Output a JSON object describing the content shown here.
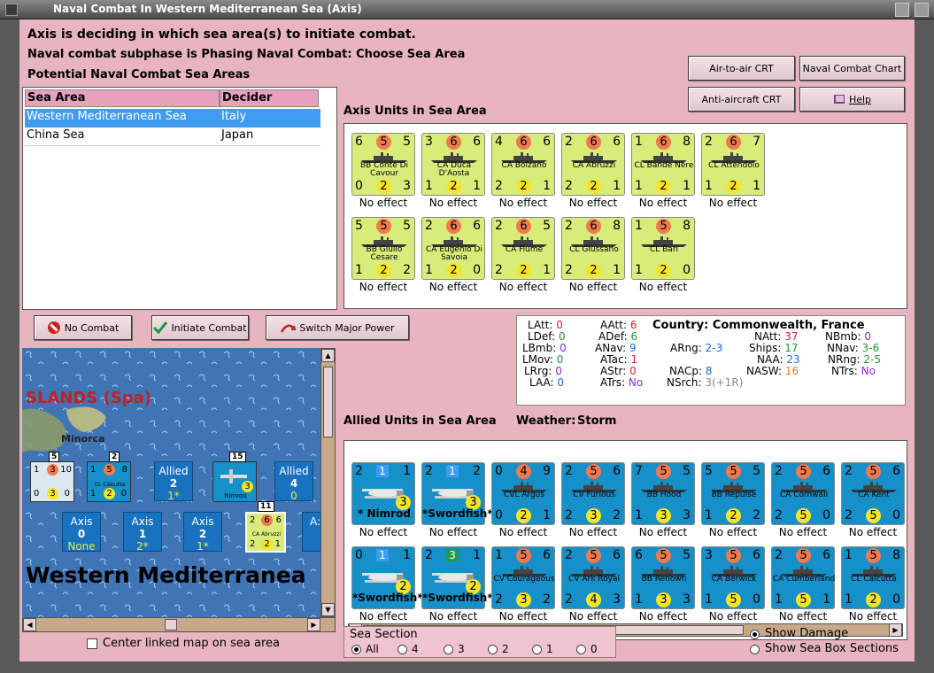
{
  "window": {
    "title": "Naval Combat In Western Mediterranean Sea (Axis)"
  },
  "header": {
    "line1": "Axis is deciding in which sea area(s) to initiate combat.",
    "line2": "Naval combat subphase is Phasing Naval Combat: Choose Sea Area",
    "line3": "Potential Naval Combat Sea Areas"
  },
  "buttons": {
    "air_to_air": "Air-to-air CRT",
    "naval_chart": "Naval Combat Chart",
    "anti_aircraft": "Anti-aircraft CRT",
    "help": "Help",
    "no_combat": "No Combat",
    "initiate_combat": "Initiate Combat",
    "switch_major": "Switch Major Power"
  },
  "sea_table": {
    "col_area": "Sea Area",
    "col_decider": "Decider",
    "rows": [
      {
        "area": "Western Mediterranean Sea",
        "decider": "Italy"
      },
      {
        "area": "China Sea",
        "decider": "Japan"
      }
    ]
  },
  "axis_panel": {
    "title": "Axis Units in Sea Area",
    "units": [
      {
        "name": "BB Conte Di Cavour",
        "tl": "6",
        "tc": "5",
        "tr": "5",
        "bl": "0",
        "bc": "2",
        "br": "3",
        "effect": "No effect"
      },
      {
        "name": "CA Duca D'Aosta",
        "tl": "3",
        "tc": "6",
        "tr": "6",
        "bl": "1",
        "bc": "2",
        "br": "1",
        "effect": "No effect"
      },
      {
        "name": "CA Bolzano",
        "tl": "4",
        "tc": "6",
        "tr": "6",
        "bl": "2",
        "bc": "2",
        "br": "1",
        "effect": "No effect"
      },
      {
        "name": "CA Abruzzi",
        "tl": "2",
        "tc": "6",
        "tr": "6",
        "bl": "2",
        "bc": "2",
        "br": "1",
        "effect": "No effect"
      },
      {
        "name": "CL Bande Nere",
        "tl": "1",
        "tc": "6",
        "tr": "8",
        "bl": "1",
        "bc": "2",
        "br": "1",
        "effect": "No effect"
      },
      {
        "name": "CL Attendolo",
        "tl": "2",
        "tc": "6",
        "tr": "7",
        "bl": "1",
        "bc": "2",
        "br": "1",
        "effect": "No effect"
      },
      {
        "name": "BB Giulio Cesare",
        "tl": "5",
        "tc": "5",
        "tr": "5",
        "bl": "1",
        "bc": "2",
        "br": "2",
        "effect": "No effect"
      },
      {
        "name": "CA Eugenio Di Savoia",
        "tl": "2",
        "tc": "6",
        "tr": "6",
        "bl": "1",
        "bc": "2",
        "br": "0",
        "effect": "No effect"
      },
      {
        "name": "CA Fiume",
        "tl": "2",
        "tc": "6",
        "tr": "5",
        "bl": "2",
        "bc": "2",
        "br": "1",
        "effect": "No effect"
      },
      {
        "name": "CL Giussano",
        "tl": "2",
        "tc": "6",
        "tr": "8",
        "bl": "2",
        "bc": "2",
        "br": "1",
        "effect": "No effect"
      },
      {
        "name": "CL Bari",
        "tl": "1",
        "tc": "5",
        "tr": "8",
        "bl": "1",
        "bc": "2",
        "br": "0",
        "effect": "No effect"
      }
    ]
  },
  "stats": {
    "latt": "LAtt:",
    "latt_v": "0",
    "ldef": "LDef:",
    "ldef_v": "0",
    "lbmb": "LBmb:",
    "lbmb_v": "0",
    "lmov": "LMov:",
    "lmov_v": "0",
    "lrrg": "LRrg:",
    "lrrg_v": "0",
    "laa": "LAA:",
    "laa_v": "0",
    "aatt": "AAtt:",
    "aatt_v": "6",
    "adef": "ADef:",
    "adef_v": "6",
    "anav": "ANav:",
    "anav_v": "9",
    "atac": "ATac:",
    "atac_v": "1",
    "astr": "AStr:",
    "astr_v": "0",
    "atrs": "ATrs:",
    "atrs_v": "No",
    "country_label": "Country:",
    "country": "Commonwealth, France",
    "arng": "ARng:",
    "arng_v": "2-3",
    "nacp": "NACp:",
    "nacp_v": "8",
    "nsrch": "NSrch:",
    "nsrch_v": "3(+1R)",
    "natt": "NAtt:",
    "natt_v": "37",
    "ships": "Ships:",
    "ships_v": "17",
    "naa": "NAA:",
    "naa_v": "23",
    "nasw": "NASW:",
    "nasw_v": "16",
    "nbmb": "NBmb:",
    "nbmb_v": "0",
    "nnav": "NNav:",
    "nnav_v": "3-6",
    "nrng": "NRng:",
    "nrng_v": "2-5",
    "ntrs": "NTrs:",
    "ntrs_v": "No",
    "colors": {
      "red": "#e0202a",
      "green": "#1a9a3a",
      "blue": "#1a6ad8",
      "orange": "#e0801a",
      "purple": "#8a2ad8",
      "gray": "#888888"
    }
  },
  "allied_panel": {
    "title": "Allied Units in Sea Area",
    "weather_label": "Weather:",
    "weather": "Storm",
    "units": [
      {
        "kind": "plane",
        "name": "* Nimrod",
        "tl": "2",
        "sq": "1",
        "tr": "1",
        "bc": "3",
        "effect": "No effect"
      },
      {
        "kind": "plane",
        "name": "*Swordfish*",
        "tl": "2",
        "sq": "1",
        "tr": "2",
        "bc": "3",
        "effect": "No effect"
      },
      {
        "kind": "ship",
        "name": "CVL Argus",
        "tl": "0",
        "tc": "4",
        "tr": "9",
        "bl": "0",
        "bc": "2",
        "br": "1",
        "effect": "No effect"
      },
      {
        "kind": "ship",
        "name": "CV Furious",
        "tl": "2",
        "tc": "5",
        "tr": "6",
        "bl": "2",
        "bc": "3",
        "br": "2",
        "effect": "No effect"
      },
      {
        "kind": "ship",
        "name": "BB Hood",
        "tl": "7",
        "tc": "5",
        "tr": "5",
        "bl": "1",
        "bc": "3",
        "br": "3",
        "effect": "No effect"
      },
      {
        "kind": "ship",
        "name": "BB Repulse",
        "tl": "5",
        "tc": "5",
        "tr": "5",
        "bl": "1",
        "bc": "2",
        "br": "2",
        "effect": "No effect"
      },
      {
        "kind": "ship",
        "name": "CA Cornwall",
        "tl": "2",
        "tc": "5",
        "tr": "6",
        "bl": "2",
        "bc": "5",
        "br": "0",
        "effect": "No effect"
      },
      {
        "kind": "ship",
        "name": "CA Kent",
        "tl": "2",
        "tc": "5",
        "tr": "6",
        "bl": "2",
        "bc": "5",
        "br": "0",
        "effect": "No effect"
      },
      {
        "kind": "plane",
        "name": "*Swordfish*",
        "tl": "0",
        "sq": "1",
        "tr": "1",
        "bc": "2",
        "effect": "No effect"
      },
      {
        "kind": "plane",
        "name": "*Swordfish*",
        "tl": "2",
        "sq": "3",
        "tr": "1",
        "bc": "2",
        "effect": "No effect"
      },
      {
        "kind": "ship",
        "name": "CV Courageous",
        "tl": "1",
        "tc": "5",
        "tr": "6",
        "bl": "2",
        "bc": "3",
        "br": "2",
        "effect": "No effect"
      },
      {
        "kind": "ship",
        "name": "CV Ark Royal",
        "tl": "2",
        "tc": "5",
        "tr": "6",
        "bl": "2",
        "bc": "4",
        "br": "3",
        "effect": "No effect"
      },
      {
        "kind": "ship",
        "name": "BB Renown",
        "tl": "6",
        "tc": "5",
        "tr": "5",
        "bl": "1",
        "bc": "3",
        "br": "3",
        "effect": "No effect"
      },
      {
        "kind": "ship",
        "name": "CA Berwick",
        "tl": "3",
        "tc": "5",
        "tr": "6",
        "bl": "1",
        "bc": "5",
        "br": "0",
        "effect": "No effect"
      },
      {
        "kind": "ship",
        "name": "CA Cumberland",
        "tl": "2",
        "tc": "5",
        "tr": "6",
        "bl": "1",
        "bc": "5",
        "br": "1",
        "effect": "No effect"
      },
      {
        "kind": "ship",
        "name": "CL Calcutta",
        "tl": "1",
        "tc": "5",
        "tr": "8",
        "bl": "1",
        "bc": "2",
        "br": "0",
        "effect": "No effect"
      }
    ]
  },
  "map": {
    "islands_label": "SLANDS (Spa)",
    "minorca": "Minorca",
    "sea_name": "Western Mediterranea",
    "stack1_count": "5",
    "stack2_count": "2",
    "stack3_count": "15",
    "stack4_count": "11",
    "stack1": {
      "tl": "1",
      "tc": "3",
      "tr": "10",
      "bl": "0",
      "bc": "3",
      "br": "0"
    },
    "stack2": {
      "tl": "1",
      "tc": "5",
      "tr": "8",
      "name": "CL Calcutta",
      "bl": "1",
      "bc": "2",
      "br": "0"
    },
    "stack3": {
      "name": "Nimrod",
      "bc": "3"
    },
    "stack4": {
      "tl": "2",
      "tc": "6",
      "tr": "6",
      "name": "CA Abruzzi",
      "bl": "2",
      "bc": "2",
      "br": "1"
    },
    "boxes": [
      {
        "t": "Allied",
        "v": "2",
        "y": "1*"
      },
      {
        "t": "Allied",
        "v": "4",
        "y": "0"
      },
      {
        "t": "Axis",
        "v": "0",
        "y": "None"
      },
      {
        "t": "Axis",
        "v": "1",
        "y": "2*"
      },
      {
        "t": "Axis",
        "v": "2",
        "y": "1*"
      }
    ],
    "partial_box": "A:"
  },
  "center_map": {
    "label": "Center linked map on sea area"
  },
  "sea_section": {
    "title": "Sea Section",
    "options": [
      "All",
      "4",
      "3",
      "2",
      "1",
      "0"
    ],
    "selected": "All"
  },
  "display_options": {
    "show_damage": "Show Damage",
    "show_boxes": "Show Sea Box Sections"
  }
}
